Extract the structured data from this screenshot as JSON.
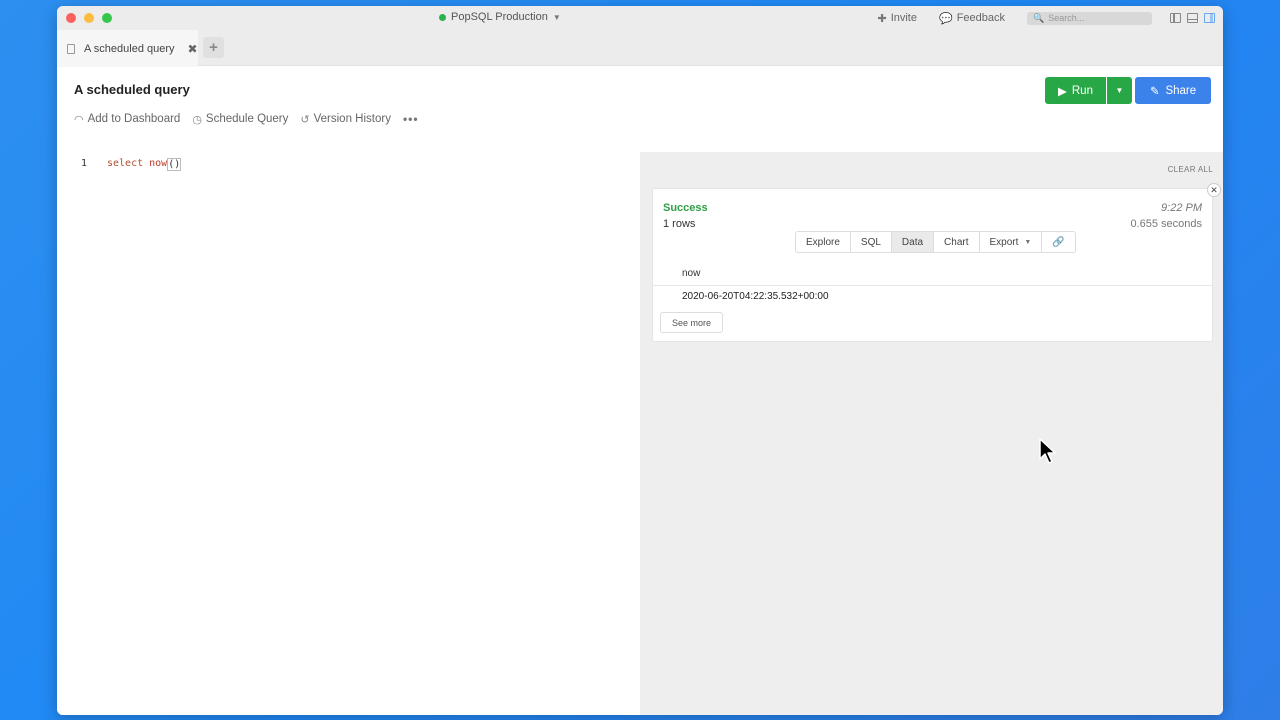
{
  "window": {
    "connection": "PopSQL Production",
    "invite": "Invite",
    "feedback": "Feedback",
    "search_placeholder": "Search..."
  },
  "tabs": [
    {
      "label": "A scheduled query"
    }
  ],
  "header": {
    "title": "A scheduled query",
    "actions": {
      "add_dashboard": "Add to Dashboard",
      "schedule": "Schedule Query",
      "history": "Version History",
      "more": "•••"
    },
    "run_label": "Run",
    "share_label": "Share"
  },
  "editor": {
    "line_number": "1",
    "keyword": "select",
    "function": "now",
    "parens": "()"
  },
  "results": {
    "clear_all": "CLEAR ALL",
    "status": "Success",
    "rows": "1 rows",
    "time": "9:22 PM",
    "duration": "0.655 seconds",
    "view_tabs": [
      "Explore",
      "SQL",
      "Data",
      "Chart",
      "Export"
    ],
    "active_view": "Data",
    "column": "now",
    "value": "2020-06-20T04:22:35.532+00:00",
    "see_more": "See more"
  },
  "colors": {
    "accent_green": "#27a745",
    "accent_blue": "#3b82ea",
    "success_text": "#2f9e44"
  }
}
